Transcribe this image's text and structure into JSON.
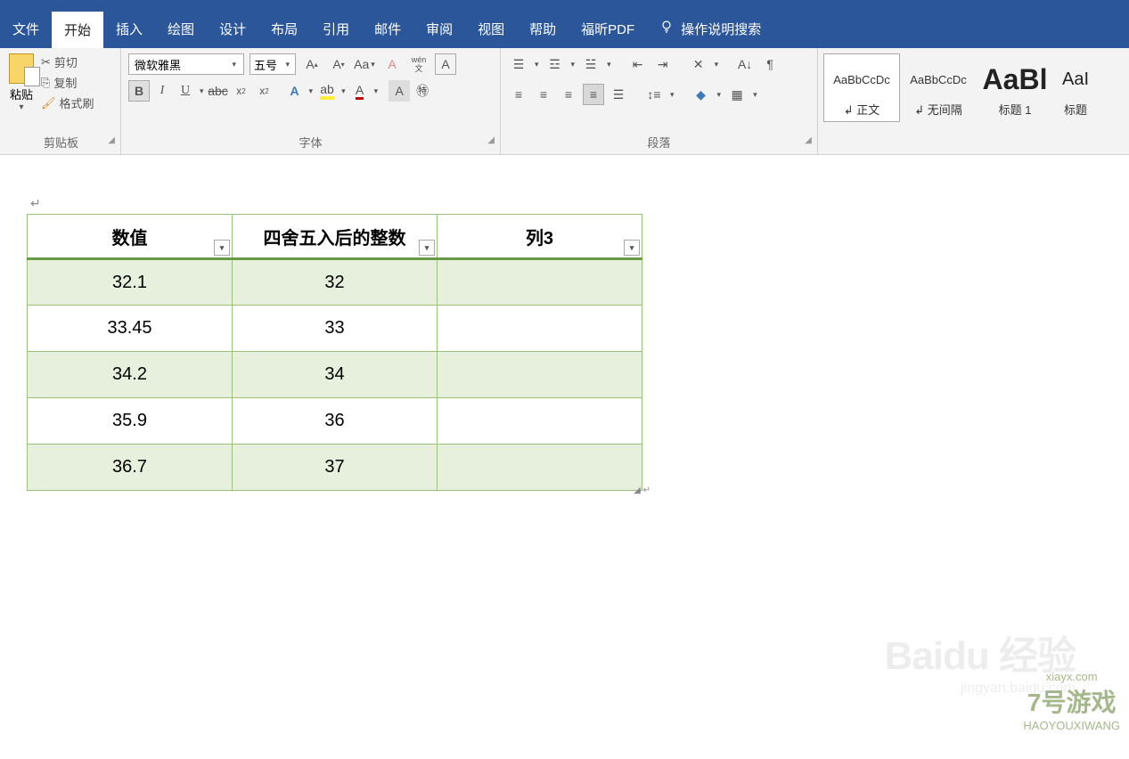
{
  "menu": {
    "file": "文件",
    "home": "开始",
    "insert": "插入",
    "draw": "绘图",
    "design": "设计",
    "layout": "布局",
    "ref": "引用",
    "mail": "邮件",
    "review": "审阅",
    "view": "视图",
    "help": "帮助",
    "foxit": "福昕PDF",
    "search": "操作说明搜索"
  },
  "clipboard": {
    "paste": "粘贴",
    "cut": "剪切",
    "copy": "复制",
    "painter": "格式刷",
    "label": "剪贴板"
  },
  "font": {
    "name": "微软雅黑",
    "size": "五号",
    "wen": "wén",
    "wencn": "文",
    "label": "字体"
  },
  "para": {
    "label": "段落"
  },
  "styles": {
    "body": {
      "prev": "AaBbCcDc",
      "name": "↲ 正文"
    },
    "nospace": {
      "prev": "AaBbCcDc",
      "name": "↲ 无间隔"
    },
    "h1": {
      "prev": "AaBl",
      "name": "标题 1"
    },
    "h2": {
      "prev": "AaI",
      "name": "标题"
    }
  },
  "table": {
    "headers": [
      "数值",
      "四舍五入后的整数",
      "列3"
    ],
    "rows": [
      [
        "32.1",
        "32",
        ""
      ],
      [
        "33.45",
        "33",
        ""
      ],
      [
        "34.2",
        "34",
        ""
      ],
      [
        "35.9",
        "36",
        ""
      ],
      [
        "36.7",
        "37",
        ""
      ]
    ]
  },
  "watermark": {
    "title": "Baidu 经验",
    "sub": "jingyan.baidu.com",
    "wm2a": "7号游戏",
    "wm2b": "HAOYOUXIWANG",
    "url": "xiayx.com"
  }
}
